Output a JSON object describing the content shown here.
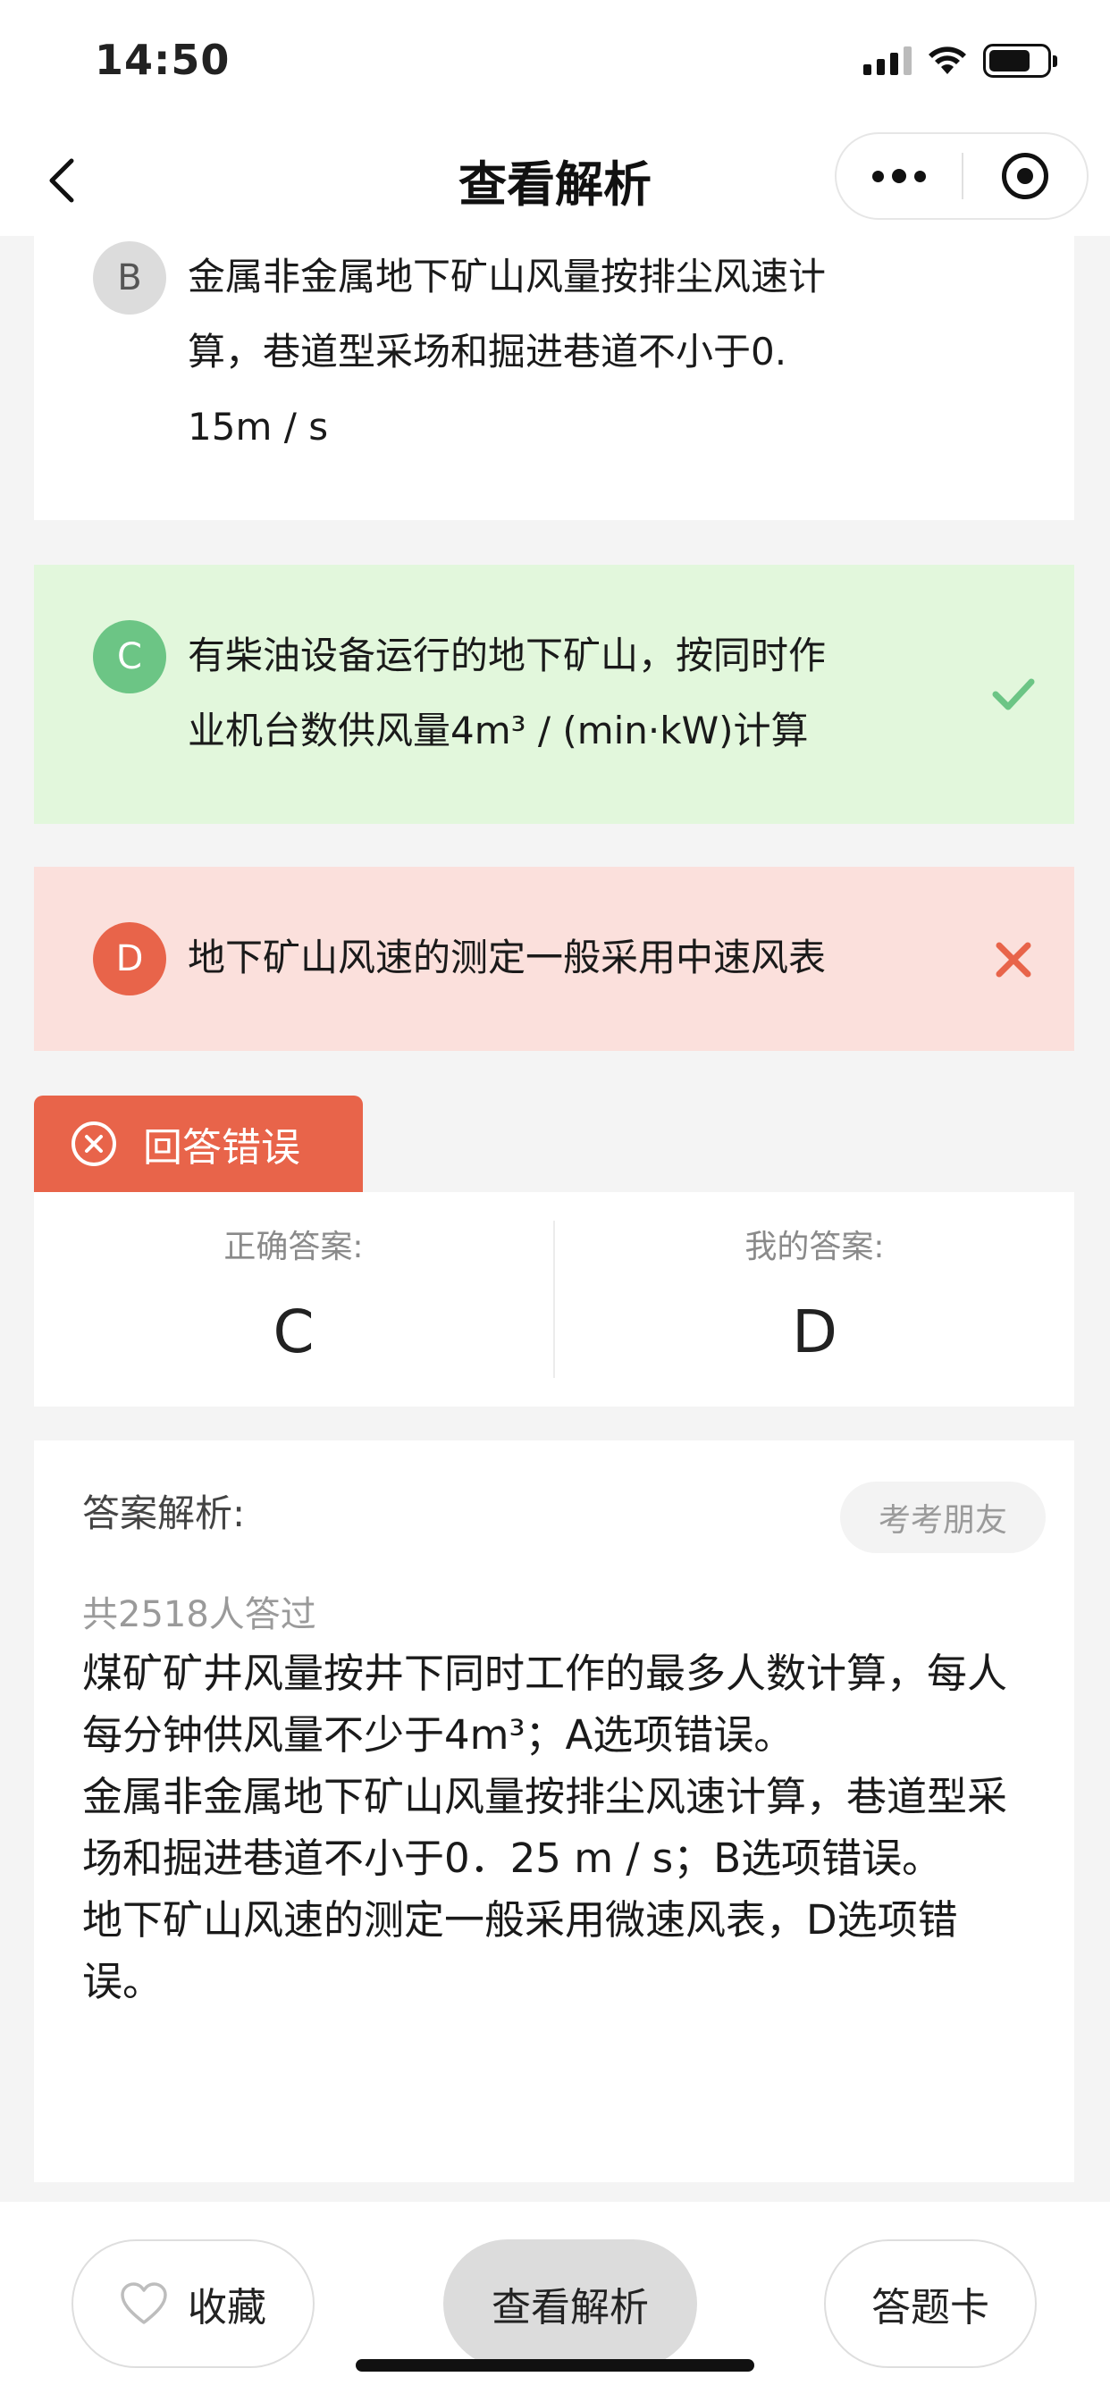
{
  "status_bar": {
    "time": "14:50"
  },
  "nav": {
    "title": "查看解析"
  },
  "options": [
    {
      "letter": "B",
      "lines": [
        "金属非金属地下矿山风量按排尘风速计",
        "算，巷道型采场和掘进巷道不小于0.",
        "15m / s"
      ],
      "state": "normal"
    },
    {
      "letter": "C",
      "lines": [
        "有柴油设备运行的地下矿山，按同时作",
        "业机台数供风量4m³ / (min·kW)计算"
      ],
      "state": "correct"
    },
    {
      "letter": "D",
      "lines": [
        "地下矿山风速的测定一般采用中速风表"
      ],
      "state": "wrong"
    }
  ],
  "result": {
    "label": "回答错误"
  },
  "answers": {
    "correct_label": "正确答案:",
    "correct_value": "C",
    "mine_label": "我的答案:",
    "mine_value": "D"
  },
  "analysis": {
    "title": "答案解析:",
    "friends_button": "考考朋友",
    "count_text": "共2518人答过",
    "paragraphs": [
      "煤矿矿井风量按井下同时工作的最多人数计算，每人每分钟供风量不少于4m³；A选项错误。",
      "金属非金属地下矿山风量按排尘风速计算，巷道型采场和掘进巷道不小于0．25 m / s；B选项错误。",
      "地下矿山风速的测定一般采用微速风表，D选项错误。"
    ]
  },
  "bottom_bar": {
    "favorite_label": "收藏",
    "view_analysis_label": "查看解析",
    "answer_card_label": "答题卡"
  },
  "colors": {
    "correct_bg": "#e2f7dc",
    "correct_accent": "#6cc585",
    "wrong_bg": "#fbe0dc",
    "wrong_accent": "#e8644a"
  }
}
